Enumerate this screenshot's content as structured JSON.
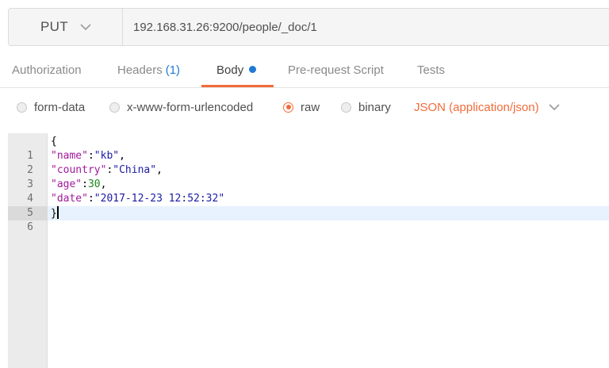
{
  "request": {
    "method": "PUT",
    "url": "192.168.31.26:9200/people/_doc/1"
  },
  "tabs": [
    {
      "label": "Authorization",
      "count": ""
    },
    {
      "label": "Headers",
      "count": "(1)"
    },
    {
      "label": "Body",
      "count": ""
    },
    {
      "label": "Pre-request Script",
      "count": ""
    },
    {
      "label": "Tests",
      "count": ""
    }
  ],
  "active_tab": "Body",
  "body_modes": {
    "options": [
      "form-data",
      "x-www-form-urlencoded",
      "raw",
      "binary"
    ],
    "selected": "raw",
    "content_type": "JSON (application/json)"
  },
  "editor": {
    "line_numbers": [
      "1",
      "2",
      "3",
      "4",
      "5",
      "6"
    ],
    "active_line": "6",
    "lines": [
      {
        "tokens": [
          {
            "t": "{",
            "k": "pun"
          }
        ]
      },
      {
        "tokens": [
          {
            "t": "\"name\"",
            "k": "key"
          },
          {
            "t": ":",
            "k": "pun"
          },
          {
            "t": "\"kb\"",
            "k": "str"
          },
          {
            "t": ",",
            "k": "pun"
          }
        ]
      },
      {
        "tokens": [
          {
            "t": "\"country\"",
            "k": "key"
          },
          {
            "t": ":",
            "k": "pun"
          },
          {
            "t": "\"China\"",
            "k": "str"
          },
          {
            "t": ",",
            "k": "pun"
          }
        ]
      },
      {
        "tokens": [
          {
            "t": "\"age\"",
            "k": "key"
          },
          {
            "t": ":",
            "k": "pun"
          },
          {
            "t": "30",
            "k": "num"
          },
          {
            "t": ",",
            "k": "pun"
          }
        ]
      },
      {
        "tokens": [
          {
            "t": "\"date\"",
            "k": "key"
          },
          {
            "t": ":",
            "k": "pun"
          },
          {
            "t": "\"2017-12-23 12:52:32\"",
            "k": "str"
          }
        ]
      },
      {
        "tokens": [
          {
            "t": "}",
            "k": "pun"
          }
        ]
      }
    ]
  },
  "icons": {
    "method_chevron": "chevron-down-icon",
    "content_type_chevron": "chevron-down-icon",
    "fold": "fold-caret-icon"
  },
  "colors": {
    "accent": "#f26b3a",
    "blue": "#1f7ad6"
  }
}
